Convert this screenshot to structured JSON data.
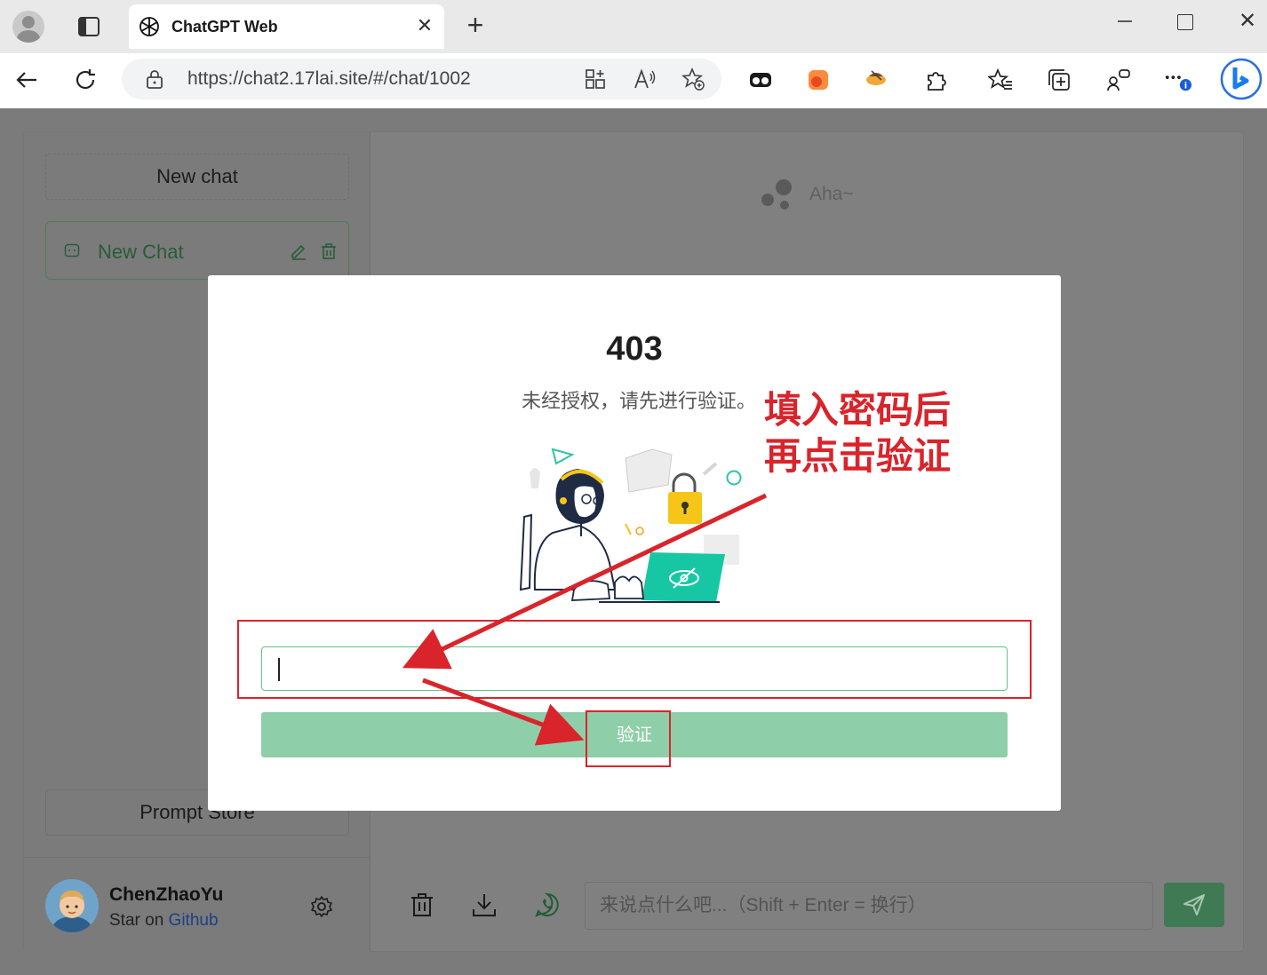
{
  "browser": {
    "tab_title": "ChatGPT Web",
    "tab_close": "✕",
    "new_tab": "+",
    "url": "https://chat2.17lai.site/#/chat/1002",
    "window_close": "✕"
  },
  "sidebar": {
    "new_chat_label": "New chat",
    "chat_items": [
      {
        "label": "New Chat"
      }
    ],
    "prompt_store_label": "Prompt Store",
    "user": {
      "name": "ChenZhaoYu",
      "star_prefix": "Star on ",
      "github_link": "Github"
    }
  },
  "main": {
    "header_text": "Aha~",
    "input_placeholder": "来说点什么吧...（Shift + Enter = 换行）"
  },
  "modal": {
    "title": "403",
    "description": "未经授权，请先进行验证。",
    "password_value": "",
    "verify_label": "验证"
  },
  "annotation": {
    "line1": "填入密码后",
    "line2": "再点击验证"
  },
  "colors": {
    "accent_green": "#18a058",
    "annotation_red": "#d9242b"
  }
}
